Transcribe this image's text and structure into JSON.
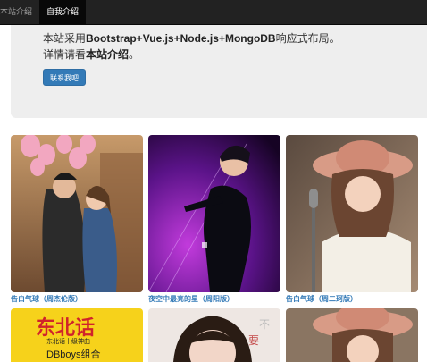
{
  "nav": {
    "home": "本站介绍",
    "about": "自我介绍"
  },
  "jumbotron": {
    "line1_prefix": "本站采用",
    "line1_bold": "Bootstrap+Vue.js+Node.js+MongoDB",
    "line1_suffix": "响应式布局。",
    "line2_prefix": "详情请看",
    "line2_bold": "本站介绍",
    "line2_suffix": "。",
    "button": "联系我吧"
  },
  "songs": [
    {
      "caption": "告白气球（周杰伦版）",
      "image": "couple-with-pink-balloons"
    },
    {
      "caption": "夜空中最亮的星（周阳版）",
      "image": "singer-on-purple-stage"
    },
    {
      "caption": "告白气球（周二珂版）",
      "image": "singer-with-pink-hat-and-microphone"
    },
    {
      "caption": "",
      "image": "yellow-poster-东北话",
      "poster_big": "东北话",
      "poster_small": "东北话十级神曲",
      "poster_group": "DBboys组合"
    },
    {
      "caption": "",
      "image": "girl-portrait"
    },
    {
      "caption": "",
      "image": "singer-with-pink-hat"
    }
  ],
  "colors": {
    "navbar": "#222222",
    "jumbotron": "#eeeeee",
    "primary": "#337ab7",
    "link": "#337ab7"
  }
}
